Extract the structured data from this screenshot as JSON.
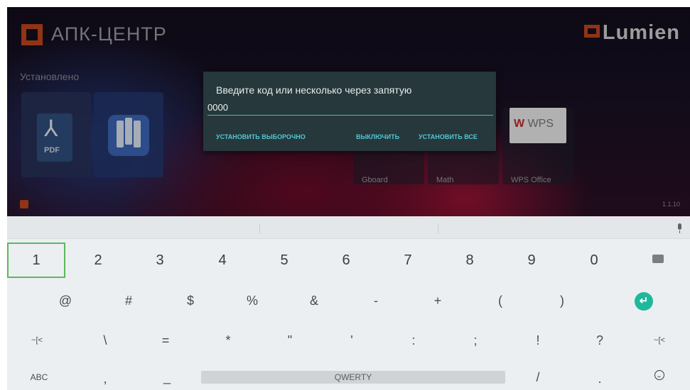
{
  "launcher": {
    "title": "АПК-ЦЕНТР",
    "brand": "Lumien",
    "installed_label": "Установлено",
    "pdf_icon_text": "PDF",
    "version": "1.1.10",
    "apps": [
      {
        "label": "Gboard"
      },
      {
        "label": "Math"
      },
      {
        "label": "WPS Office"
      }
    ],
    "wps_icon_text": "WPS"
  },
  "dialog": {
    "title": "Введите код или несколько через запятую",
    "input_value": "0000",
    "buttons": {
      "install_selective": "УСТАНОВИТЬ ВЫБОРОЧНО",
      "disable": "ВЫКЛЮЧИТЬ",
      "install_all": "УСТАНОВИТЬ ВСЕ"
    }
  },
  "keyboard": {
    "accent": "#20b89a",
    "focus_color": "#5cb85c",
    "row1": [
      "1",
      "2",
      "3",
      "4",
      "5",
      "6",
      "7",
      "8",
      "9",
      "0"
    ],
    "row2": [
      "@",
      "#",
      "$",
      "%",
      "&",
      "-",
      "+",
      "(",
      ")"
    ],
    "row3": [
      "~[<",
      "\\",
      "=",
      "*",
      "\"",
      "'",
      ":",
      ";",
      "!",
      "?",
      "~[<"
    ],
    "row4_left": "ABC",
    "row4_comma": ",",
    "row4_underscore": "_",
    "space_label": "QWERTY",
    "row4_slash": "/",
    "row4_dot": ".",
    "focused_key": "1"
  }
}
